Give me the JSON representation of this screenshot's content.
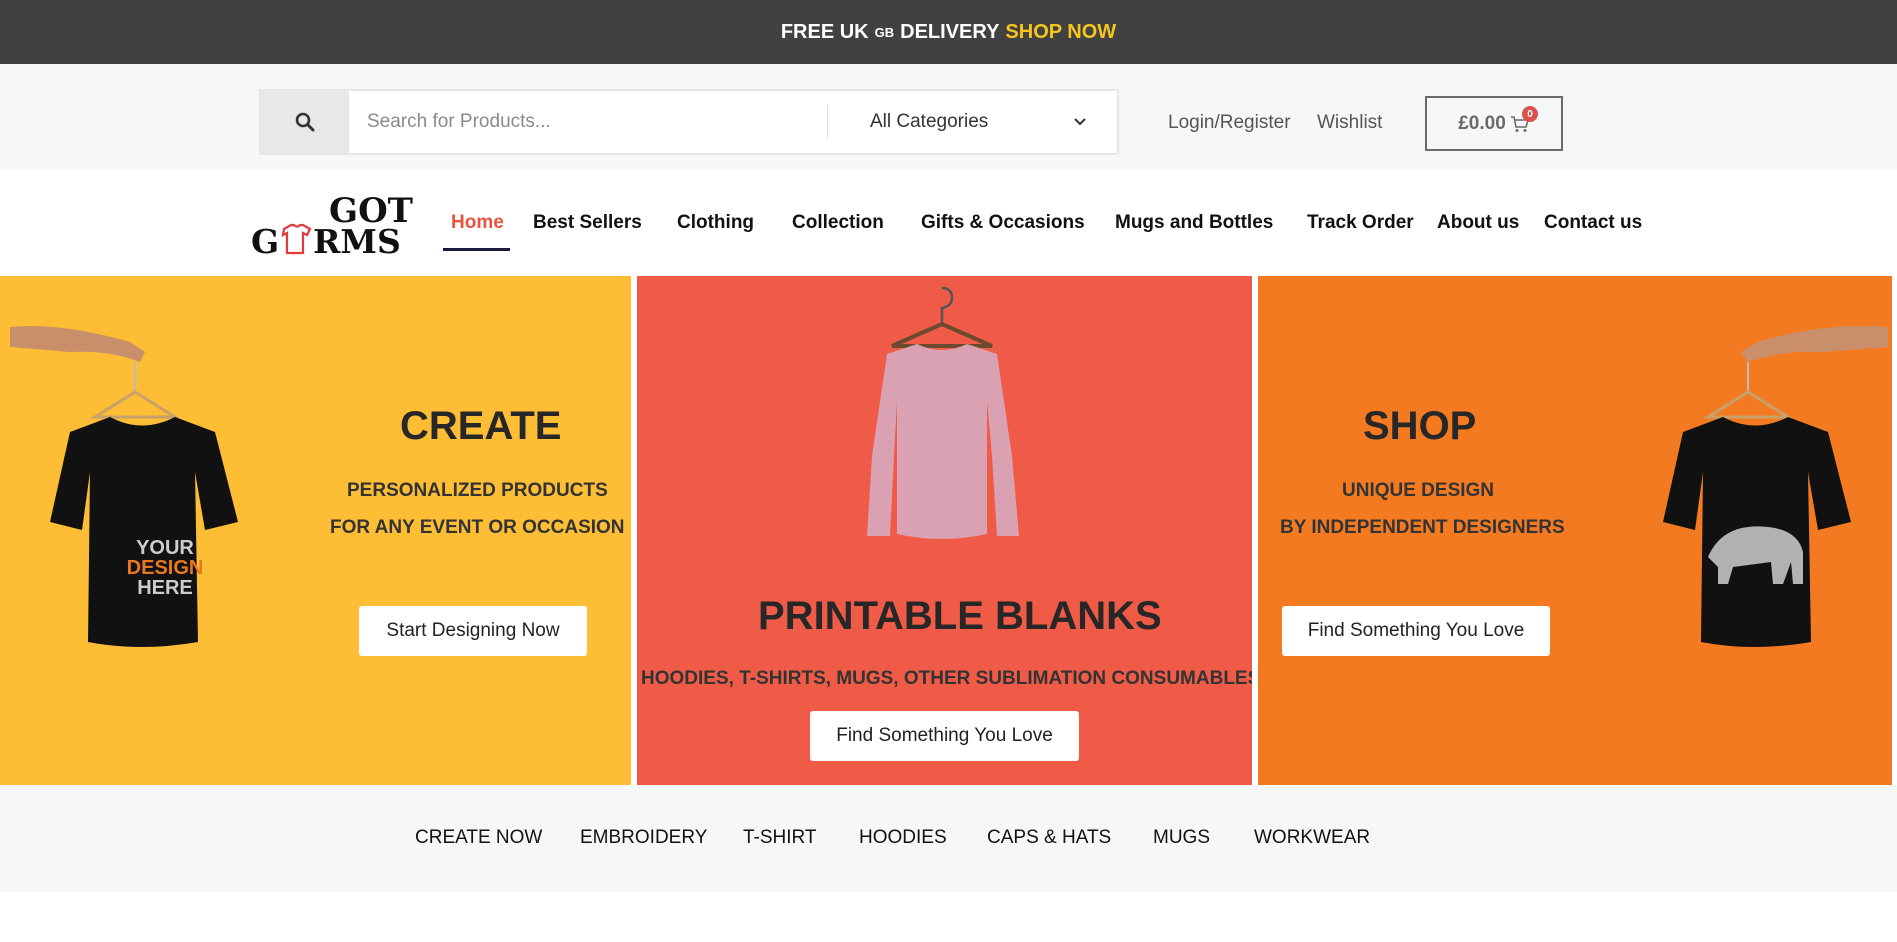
{
  "topbar": {
    "text1": "FREE UK",
    "gb": "GB",
    "text2": "DELIVERY",
    "shop_now": "SHOP NOW"
  },
  "search": {
    "placeholder": "Search for Products...",
    "category": "All Categories"
  },
  "header": {
    "login": "Login/Register",
    "wishlist": "Wishlist",
    "cart_total": "£0.00",
    "cart_count": "0"
  },
  "logo": {
    "line1": "GOT",
    "line2a": "G",
    "line2b": "RMS"
  },
  "nav": [
    "Home",
    "Best Sellers",
    "Clothing",
    "Collection",
    "Gifts & Occasions",
    "Mugs and Bottles",
    "Track Order",
    "About us",
    "Contact us"
  ],
  "hero": {
    "create": {
      "title": "CREATE",
      "sub1": "PERSONALIZED PRODUCTS",
      "sub2": "FOR ANY EVENT OR OCCASION",
      "button": "Start Designing Now",
      "shirt_text1": "YOUR",
      "shirt_text2": "DESIGN",
      "shirt_text3": "HERE"
    },
    "blanks": {
      "title": "PRINTABLE BLANKS",
      "sub": "HOODIES, T-SHIRTS, MUGS, OTHER SUBLIMATION CONSUMABLES",
      "button": "Find Something You Love"
    },
    "shop": {
      "title": "SHOP",
      "sub1": "UNIQUE DESIGN",
      "sub2": "BY INDEPENDENT DESIGNERS",
      "button": "Find Something You Love"
    }
  },
  "categories": [
    "CREATE NOW",
    "EMBROIDERY",
    "T-SHIRT",
    "HOODIES",
    "CAPS & HATS",
    "MUGS",
    "WORKWEAR"
  ],
  "colors": {
    "topbar_bg": "#414141",
    "accent_yellow": "#f6c51d",
    "active_nav": "#e8553e",
    "panel_yellow": "#fdbd34",
    "panel_red": "#f05b47",
    "panel_orange": "#f47a22"
  }
}
